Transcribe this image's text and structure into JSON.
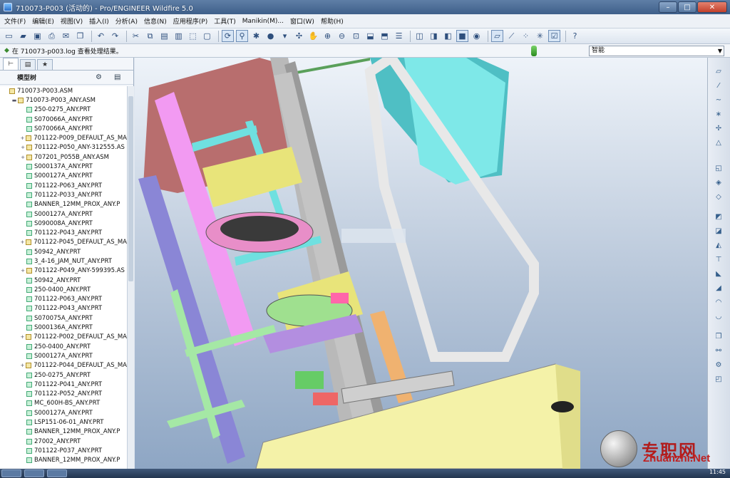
{
  "window": {
    "title": "710073-P003 (活动的) - Pro/ENGINEER Wildfire 5.0",
    "minimize": "–",
    "maximize": "□",
    "close": "✕"
  },
  "menu": [
    "文件(F)",
    "编辑(E)",
    "视图(V)",
    "插入(I)",
    "分析(A)",
    "信息(N)",
    "应用程序(P)",
    "工具(T)",
    "Manikin(M)...",
    "窗口(W)",
    "帮助(H)"
  ],
  "toolbar": {
    "icons": [
      "new-file-icon",
      "open-icon",
      "save-icon",
      "print-icon",
      "email-icon",
      "copy-icon",
      "undo-icon",
      "redo-icon",
      "cut-icon",
      "copy2-icon",
      "paste-icon",
      "paste-special-icon",
      "select-icon",
      "selection-box-icon",
      "regenerate-icon",
      "find-icon",
      "repaint-icon",
      "orient-icon",
      "appearance-icon",
      "spin-icon",
      "pan-icon",
      "zoom-in-icon",
      "zoom-out-icon",
      "refit-icon",
      "reorient-icon",
      "saved-views-icon",
      "layers-icon",
      "wireframe-icon",
      "hidden-line-icon",
      "no-hidden-icon",
      "shading-icon",
      "enhanced-realism-icon",
      "datum-planes-icon",
      "datum-axes-icon",
      "datum-points-icon",
      "coordinate-systems-icon",
      "annotations-icon",
      "whats-this-icon"
    ]
  },
  "message": {
    "text": "在 710073-p003.log 查看处理结果。",
    "filter_value": "智能"
  },
  "left_panel": {
    "tabs": [
      "model-tree-tab",
      "folder-tab",
      "favorites-tab"
    ],
    "header_title": "模型树",
    "tree": [
      {
        "label": "710073-P003.ASM",
        "level": 0,
        "type": "asm",
        "expander": ""
      },
      {
        "label": "710073-P003_ANY.ASM",
        "level": 1,
        "type": "asm",
        "expander": "▬"
      },
      {
        "label": "250-0275_ANY.PRT",
        "level": 2,
        "type": "prt",
        "expander": ""
      },
      {
        "label": "S070066A_ANY.PRT",
        "level": 2,
        "type": "prt",
        "expander": ""
      },
      {
        "label": "S070066A_ANY.PRT",
        "level": 2,
        "type": "prt",
        "expander": ""
      },
      {
        "label": "701122-P009_DEFAULT_AS_MA",
        "level": 2,
        "type": "asm",
        "expander": "+"
      },
      {
        "label": "701122-P050_ANY-312555.AS",
        "level": 2,
        "type": "asm",
        "expander": "+"
      },
      {
        "label": "707201_P055B_ANY.ASM",
        "level": 2,
        "type": "asm",
        "expander": "+"
      },
      {
        "label": "S000137A_ANY.PRT",
        "level": 2,
        "type": "prt",
        "expander": ""
      },
      {
        "label": "S000127A_ANY.PRT",
        "level": 2,
        "type": "prt",
        "expander": ""
      },
      {
        "label": "701122-P063_ANY.PRT",
        "level": 2,
        "type": "prt",
        "expander": ""
      },
      {
        "label": "701122-P033_ANY.PRT",
        "level": 2,
        "type": "prt",
        "expander": ""
      },
      {
        "label": "BANNER_12MM_PROX_ANY.P",
        "level": 2,
        "type": "prt",
        "expander": ""
      },
      {
        "label": "S000127A_ANY.PRT",
        "level": 2,
        "type": "prt",
        "expander": ""
      },
      {
        "label": "S090008A_ANY.PRT",
        "level": 2,
        "type": "prt",
        "expander": ""
      },
      {
        "label": "701122-P043_ANY.PRT",
        "level": 2,
        "type": "prt",
        "expander": ""
      },
      {
        "label": "701122-P045_DEFAULT_AS_MA",
        "level": 2,
        "type": "asm",
        "expander": "+"
      },
      {
        "label": "50942_ANY.PRT",
        "level": 2,
        "type": "prt",
        "expander": ""
      },
      {
        "label": "3_4-16_JAM_NUT_ANY.PRT",
        "level": 2,
        "type": "prt",
        "expander": ""
      },
      {
        "label": "701122-P049_ANY-599395.AS",
        "level": 2,
        "type": "asm",
        "expander": "+"
      },
      {
        "label": "50942_ANY.PRT",
        "level": 2,
        "type": "prt",
        "expander": ""
      },
      {
        "label": "250-0400_ANY.PRT",
        "level": 2,
        "type": "prt",
        "expander": ""
      },
      {
        "label": "701122-P063_ANY.PRT",
        "level": 2,
        "type": "prt",
        "expander": ""
      },
      {
        "label": "701122-P043_ANY.PRT",
        "level": 2,
        "type": "prt",
        "expander": ""
      },
      {
        "label": "S070075A_ANY.PRT",
        "level": 2,
        "type": "prt",
        "expander": ""
      },
      {
        "label": "S000136A_ANY.PRT",
        "level": 2,
        "type": "prt",
        "expander": ""
      },
      {
        "label": "701122-P002_DEFAULT_AS_MA",
        "level": 2,
        "type": "asm",
        "expander": "+"
      },
      {
        "label": "250-0400_ANY.PRT",
        "level": 2,
        "type": "prt",
        "expander": ""
      },
      {
        "label": "S000127A_ANY.PRT",
        "level": 2,
        "type": "prt",
        "expander": ""
      },
      {
        "label": "701122-P044_DEFAULT_AS_MA",
        "level": 2,
        "type": "asm",
        "expander": "+"
      },
      {
        "label": "250-0275_ANY.PRT",
        "level": 2,
        "type": "prt",
        "expander": ""
      },
      {
        "label": "701122-P041_ANY.PRT",
        "level": 2,
        "type": "prt",
        "expander": ""
      },
      {
        "label": "701122-P052_ANY.PRT",
        "level": 2,
        "type": "prt",
        "expander": ""
      },
      {
        "label": "MC_600H-BS_ANY.PRT",
        "level": 2,
        "type": "prt",
        "expander": ""
      },
      {
        "label": "S000127A_ANY.PRT",
        "level": 2,
        "type": "prt",
        "expander": ""
      },
      {
        "label": "LSP151-06-01_ANY.PRT",
        "level": 2,
        "type": "prt",
        "expander": ""
      },
      {
        "label": "BANNER_12MM_PROX_ANY.P",
        "level": 2,
        "type": "prt",
        "expander": ""
      },
      {
        "label": "27002_ANY.PRT",
        "level": 2,
        "type": "prt",
        "expander": ""
      },
      {
        "label": "701122-P037_ANY.PRT",
        "level": 2,
        "type": "prt",
        "expander": ""
      },
      {
        "label": "BANNER_12MM_PROX_ANY.P",
        "level": 2,
        "type": "prt",
        "expander": ""
      }
    ]
  },
  "right_toolbar": {
    "icons": [
      "datum-plane-icon",
      "datum-axis-icon",
      "sketched-curve-icon",
      "datum-point-icon",
      "coord-sys-icon",
      "analysis-icon",
      "hole-icon",
      "pattern-icon",
      "mirror-icon",
      "extrude-icon",
      "revolve-icon",
      "sweep-icon",
      "round-icon",
      "chamfer-icon",
      "draft-icon",
      "shell-icon",
      "rib-icon",
      "assemble-icon",
      "component-icon",
      "mechanism-icon",
      "constraint-icon"
    ]
  },
  "taskbar": {
    "clock": "11:45"
  },
  "watermark": {
    "cn": "专职网",
    "en": "Zhuanzhi.Net"
  },
  "colors": {
    "viewport_top": "#eef3f9",
    "viewport_bottom": "#8ea6c4",
    "magenta_part": "#f08ef0",
    "cyan_part": "#6fe3e3",
    "yellow_part": "#f4f2a8",
    "grey_frame": "#c8c8c8",
    "brown_part": "#b56b6b"
  }
}
